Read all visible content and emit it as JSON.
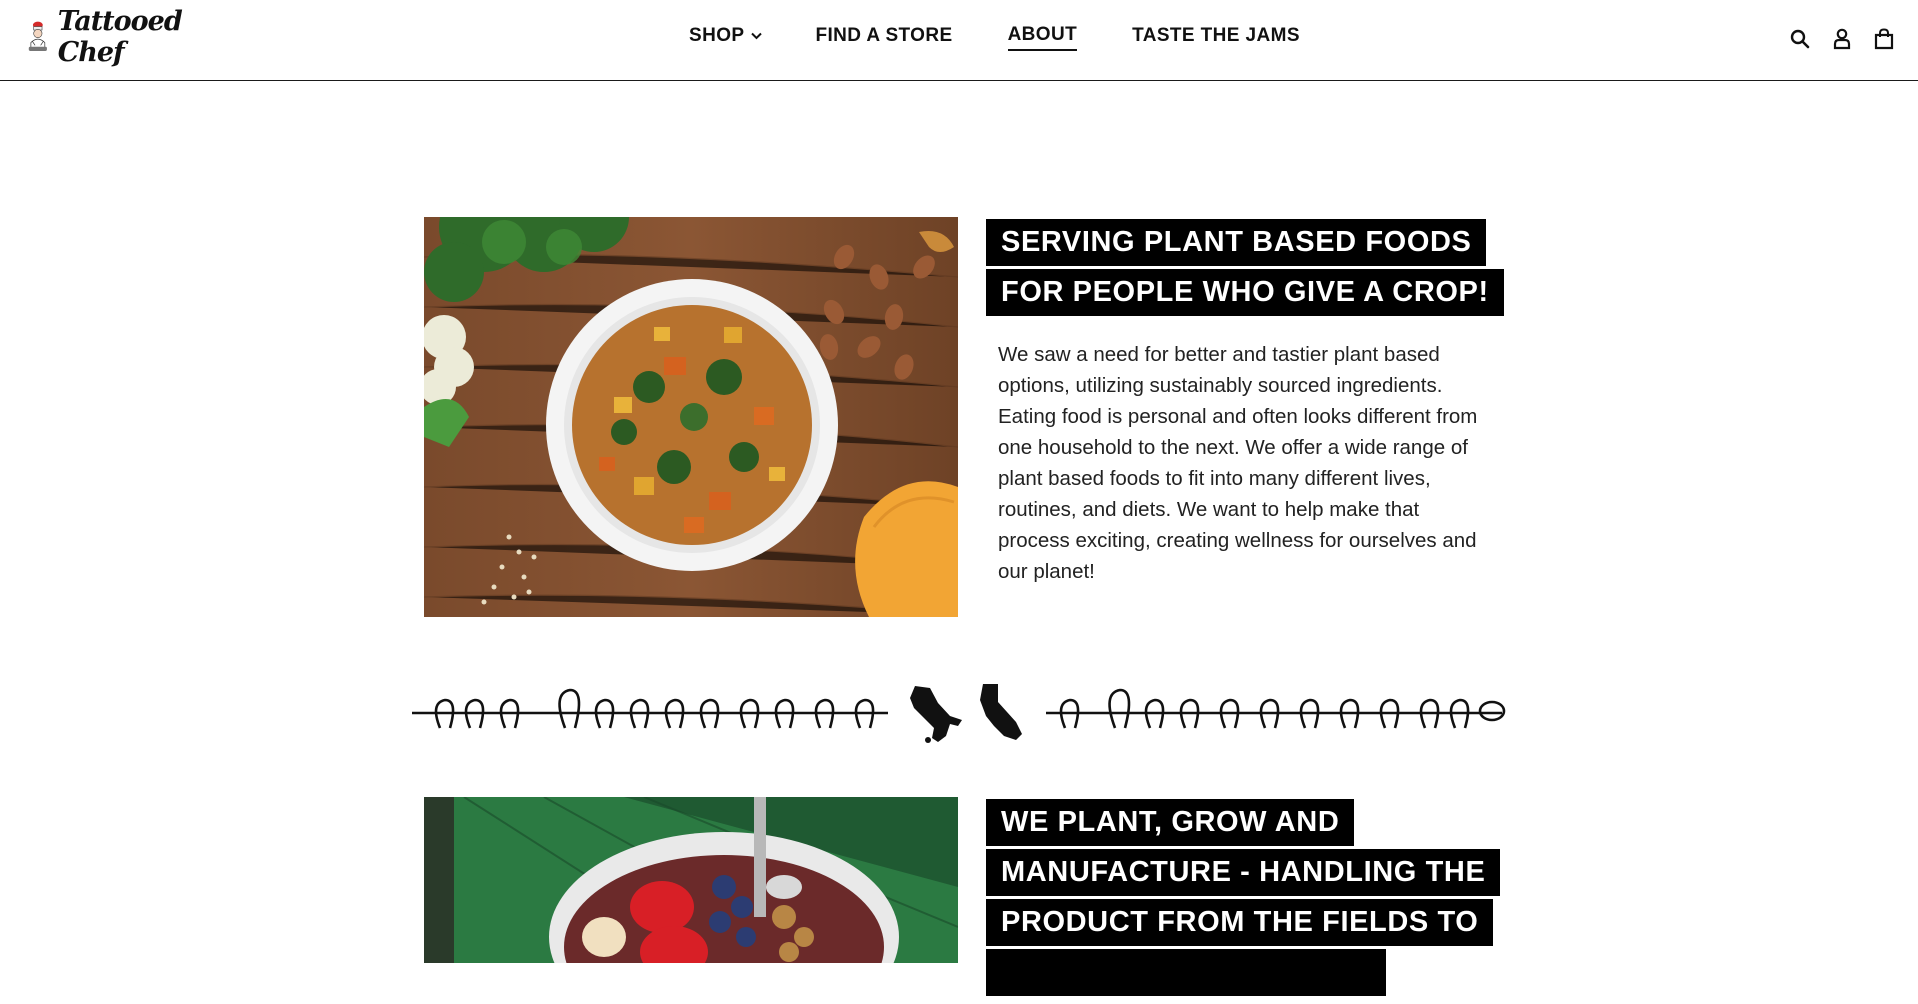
{
  "brand": {
    "name": "Tattooed Chef"
  },
  "nav": {
    "items": [
      {
        "label": "SHOP",
        "has_dropdown": true
      },
      {
        "label": "FIND A STORE"
      },
      {
        "label": "ABOUT",
        "active": true
      },
      {
        "label": "TASTE THE JAMS"
      }
    ]
  },
  "header_icons": [
    "search-icon",
    "account-icon",
    "cart-icon"
  ],
  "section1": {
    "title_lines": [
      "SERVING PLANT BASED FOODS",
      "FOR PEOPLE WHO GIVE A CROP!"
    ],
    "body": "We saw a need for better and tastier plant based options, utilizing sustainably sourced ingredients. Eating food is personal and often looks different from one household to the next. We offer a wide range of plant based foods to fit into many different lives, routines, and diets. We want to help make that process exciting, creating wellness for ourselves and our planet!",
    "image": "veggie-bowl-on-wood-table"
  },
  "section2": {
    "title_lines": [
      "WE PLANT, GROW AND",
      "MANUFACTURE - HANDLING THE",
      "PRODUCT FROM THE FIELDS TO"
    ],
    "image": "acai-bowl-on-green-leaf"
  },
  "colors": {
    "title_bg": "#000000",
    "title_fg": "#ffffff",
    "text": "#222222",
    "border": "#1a1a1a"
  }
}
